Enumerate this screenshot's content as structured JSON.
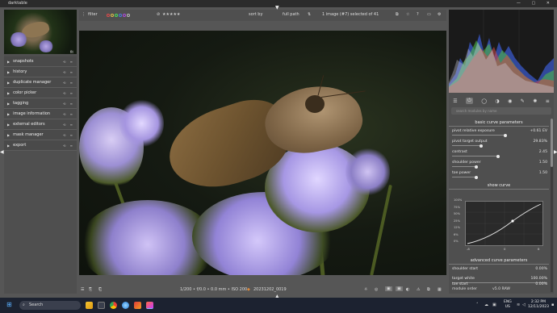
{
  "window": {
    "title": "darktable",
    "controls": "— ▢ ✕"
  },
  "top_toolbar": {
    "filter_label": "filter",
    "sort_label": "sort by",
    "sort_value": "full path",
    "status": "1 image (#7) selected of 41",
    "rating_stars": "★★★★★"
  },
  "left_panel": {
    "fit_label": "fit",
    "modules": [
      {
        "label": "snapshots"
      },
      {
        "label": "history"
      },
      {
        "label": "duplicate manager"
      },
      {
        "label": "color picker"
      },
      {
        "label": "tagging"
      },
      {
        "label": "image information"
      },
      {
        "label": "external editors"
      },
      {
        "label": "mask manager"
      },
      {
        "label": "export"
      }
    ]
  },
  "image_info": "1/200 • f/0.0 • 0.0 mm • ISO 200",
  "image_filename": "20231202_0019",
  "right_panel": {
    "search_placeholder": "search modules by name",
    "basic_header": "basic curve parameters",
    "params": [
      {
        "label": "pivot relative exposure",
        "value": "+0.61 EV",
        "pos": 0.55
      },
      {
        "label": "pivot target output",
        "value": "29.83%",
        "pos": 0.3
      },
      {
        "label": "contrast",
        "value": "2.45",
        "pos": 0.48
      },
      {
        "label": "shoulder power",
        "value": "1.50",
        "pos": 0.25
      },
      {
        "label": "toe power",
        "value": "1.50",
        "pos": 0.25
      }
    ],
    "curve_header": "show curve",
    "curve_y_ticks": [
      "100%",
      "75%",
      "50%",
      "25%",
      "12%",
      "6%",
      "0%"
    ],
    "curve_x_ticks": [
      "-8",
      "0",
      "8"
    ],
    "advanced_header": "advanced curve parameters",
    "adv_params": [
      {
        "label": "shoulder start",
        "value": "0.00%"
      },
      {
        "label": "target white",
        "value": "100.00%"
      },
      {
        "label": "toe start",
        "value": "0.00%"
      }
    ],
    "module_order_label": "module order",
    "module_order_value": "v5.0 RAW"
  },
  "taskbar": {
    "search_label": "Search",
    "lang": "ENG",
    "region": "US",
    "time": "2:32 PM",
    "date": "12/11/2023"
  }
}
